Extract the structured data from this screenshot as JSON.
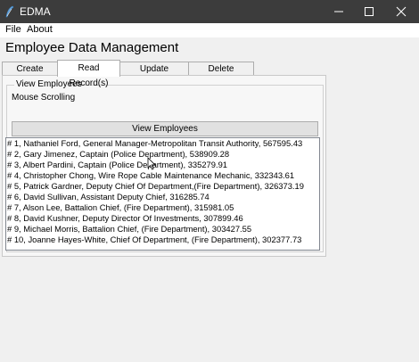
{
  "window": {
    "title": "EDMA",
    "controls": [
      "minimize-icon",
      "maximize-icon",
      "close-icon"
    ]
  },
  "menu": {
    "items": [
      "File",
      "About"
    ]
  },
  "app": {
    "heading": "Employee Data Management"
  },
  "tabs": [
    {
      "label": "Create Record",
      "active": false
    },
    {
      "label": "Read Record(s)",
      "active": true
    },
    {
      "label": "Update Record(s)",
      "active": false
    },
    {
      "label": "Delete Record(s)",
      "active": false
    }
  ],
  "panel": {
    "group_label": "View Employees",
    "mouse_label": "Mouse Scrolling",
    "button_label": "View Employees"
  },
  "employees": [
    "# 1,  Nathaniel Ford,  General Manager-Metropolitan Transit Authority,  567595.43",
    "# 2,  Gary Jimenez,  Captain (Police Department),  538909.28",
    "# 3,  Albert Pardini,  Captain (Police Department),  335279.91",
    "# 4,  Christopher Chong,  Wire Rope Cable Maintenance Mechanic,  332343.61",
    "# 5,  Patrick Gardner,  Deputy Chief Of Department,(Fire Department),  326373.19",
    "# 6,  David Sullivan,  Assistant Deputy Chief,  316285.74",
    "# 7,  Alson Lee,  Battalion Chief, (Fire Department),  315981.05",
    "# 8,  David Kushner,  Deputy Director Of Investments,  307899.46",
    "# 9,  Michael Morris,  Battalion Chief, (Fire Department),  303427.55",
    "# 10,  Joanne Hayes-White,  Chief Of Department, (Fire Department),  302377.73"
  ],
  "colors": {
    "titlebar": "#3c3c3c",
    "window_bg": "#f0f0f0",
    "list_bg": "#ffffff"
  }
}
